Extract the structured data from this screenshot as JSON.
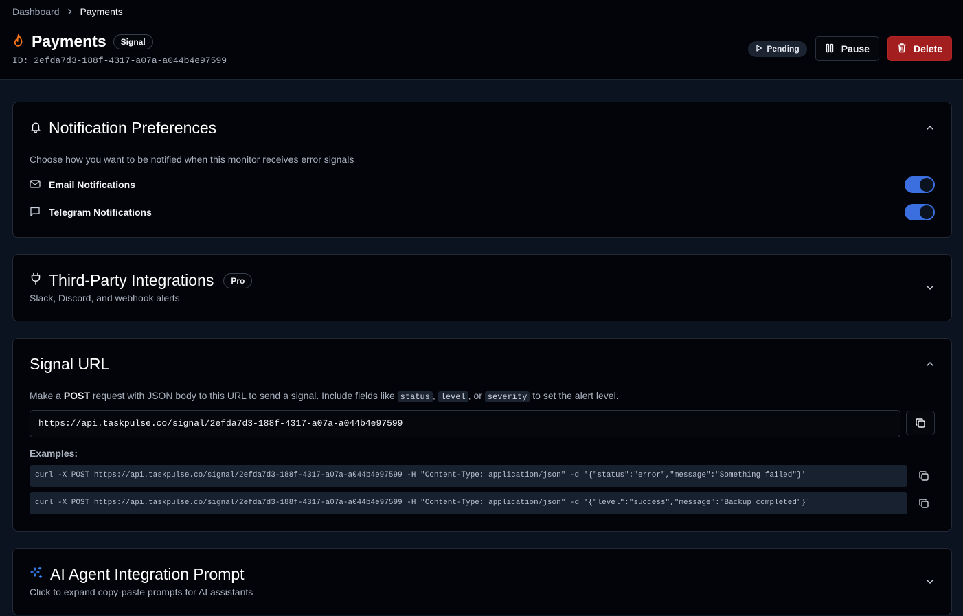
{
  "breadcrumb": {
    "parent": "Dashboard",
    "current": "Payments"
  },
  "monitor": {
    "name": "Payments",
    "type_badge": "Signal",
    "id_label": "ID: 2efda7d3-188f-4317-a07a-a044b4e97599",
    "status": "Pending"
  },
  "actions": {
    "pause": "Pause",
    "delete": "Delete"
  },
  "notifications": {
    "title": "Notification Preferences",
    "description": "Choose how you want to be notified when this monitor receives error signals",
    "items": [
      {
        "label": "Email Notifications",
        "enabled": true
      },
      {
        "label": "Telegram Notifications",
        "enabled": true
      }
    ]
  },
  "integrations": {
    "title": "Third-Party Integrations",
    "badge": "Pro",
    "subtitle": "Slack, Discord, and webhook alerts"
  },
  "signal_url": {
    "title": "Signal URL",
    "desc_prefix": "Make a ",
    "desc_method": "POST",
    "desc_mid": " request with JSON body to this URL to send a signal. Include fields like ",
    "field_status": "status",
    "sep1": ", ",
    "field_level": "level",
    "sep2": ", or ",
    "field_severity": "severity",
    "desc_suffix": " to set the alert level.",
    "url": "https://api.taskpulse.co/signal/2efda7d3-188f-4317-a07a-a044b4e97599",
    "examples_label": "Examples:",
    "examples": [
      "curl -X POST https://api.taskpulse.co/signal/2efda7d3-188f-4317-a07a-a044b4e97599 -H \"Content-Type: application/json\" -d '{\"status\":\"error\",\"message\":\"Something failed\"}'",
      "curl -X POST https://api.taskpulse.co/signal/2efda7d3-188f-4317-a07a-a044b4e97599 -H \"Content-Type: application/json\" -d '{\"level\":\"success\",\"message\":\"Backup completed\"}'"
    ]
  },
  "ai_prompt": {
    "title": "AI Agent Integration Prompt",
    "subtitle": "Click to expand copy-paste prompts for AI assistants"
  },
  "colors": {
    "accent": "#3b6fe0",
    "danger": "#a31f1f",
    "flame": "#f97316",
    "sparkle": "#3b82f6"
  }
}
